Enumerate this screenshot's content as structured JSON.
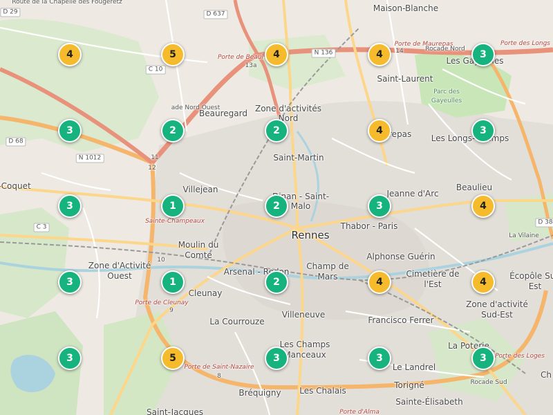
{
  "colors": {
    "green": "#16b37f",
    "amber": "#f6bb2c",
    "water": "#aad3df",
    "park": "#c8e6b8",
    "road": "#f5b56b"
  },
  "markers": [
    {
      "count": "4",
      "status": "amber"
    },
    {
      "count": "5",
      "status": "amber"
    },
    {
      "count": "4",
      "status": "amber"
    },
    {
      "count": "4",
      "status": "amber"
    },
    {
      "count": "3",
      "status": "green"
    },
    {
      "count": "3",
      "status": "green"
    },
    {
      "count": "2",
      "status": "green"
    },
    {
      "count": "2",
      "status": "green"
    },
    {
      "count": "4",
      "status": "amber"
    },
    {
      "count": "3",
      "status": "green"
    },
    {
      "count": "3",
      "status": "green"
    },
    {
      "count": "1",
      "status": "green"
    },
    {
      "count": "2",
      "status": "green"
    },
    {
      "count": "3",
      "status": "green"
    },
    {
      "count": "4",
      "status": "amber"
    },
    {
      "count": "3",
      "status": "green"
    },
    {
      "count": "1",
      "status": "green"
    },
    {
      "count": "2",
      "status": "green"
    },
    {
      "count": "4",
      "status": "amber"
    },
    {
      "count": "4",
      "status": "amber"
    },
    {
      "count": "3",
      "status": "green"
    },
    {
      "count": "5",
      "status": "amber"
    },
    {
      "count": "3",
      "status": "green"
    },
    {
      "count": "3",
      "status": "green"
    },
    {
      "count": "3",
      "status": "green"
    }
  ],
  "labels": {
    "rennes": "Rennes",
    "maison_blanche": "Maison-Blanche",
    "saint_laurent": "Saint-Laurent",
    "beauregard": "Beauregard",
    "zone_nord_1": "Zone d'activités",
    "zone_nord_2": "Nord",
    "saint_martin": "Saint-Martin",
    "villejean": "Villejean",
    "dinan_1": "Dinan - Saint-",
    "dinan_2": "Malo",
    "thabor": "Thabor - Paris",
    "jeanne": "Jeanne d'Arc",
    "beaulieu": "Beaulieu",
    "les_gayeulles": "Les Gayeulles",
    "les_longs_champs": "Les Longs-Champs",
    "maurepas": "Maurepas",
    "moulin_1": "Moulin du",
    "moulin_2": "Comte",
    "zone_ouest_1": "Zone d'Activité",
    "zone_ouest_2": "Ouest",
    "arsenal": "Arsenal - Redon",
    "champ_1": "Champ de",
    "champ_2": "Mars",
    "alphonse": "Alphonse Guérin",
    "cimetiere_1": "Cimetière de",
    "cimetiere_2": "l'Est",
    "ecopole_1": "Écopôle Sud",
    "ecopole_2": "Est",
    "zone_se_1": "Zone d'activité",
    "zone_se_2": "Sud-Est",
    "cleunay": "Cleunay",
    "la_courrouze": "La Courrouze",
    "villeneuve": "Villeneuve",
    "francisco": "Francisco Ferrer",
    "champs_manceaux_1": "Les Champs",
    "champs_manceaux_2": "Manceaux",
    "le_landrel": "Le Landrel",
    "torigne": "Torigné",
    "sainte_elisabeth": "Sainte-Élisabeth",
    "la_poterie": "La Poterie",
    "les_chalais": "Les Chalais",
    "brequigny": "Bréquigny",
    "saint_jacques": "Saint-Jacques",
    "coquet": "-Coquet",
    "ch": "Ch"
  },
  "roads": {
    "d29": "D 29",
    "d637": "D 637",
    "n136": "N 136",
    "c10": "C 10",
    "d68": "D 68",
    "n1012": "N 1012",
    "c3": "C 3",
    "d38": "D 38"
  },
  "small_labels": {
    "route_chapelle": "Route de la Chapelle des Fougeretz",
    "porte_beaulieu": "Porte de Beaul",
    "porte_maurepas": "Porte de Maurepas",
    "rocade_nord": "Rocade Nord",
    "porte_longs": "Porte des Longs",
    "rue_nord_ouest": "ade Nord Ouest",
    "porte_cleunay": "Porte de Cleunay",
    "porte_saint_nazaire": "Porte de Saint-Nazaire",
    "porte_loges": "Porte des Loges",
    "porte_alma": "Porte d'Alma",
    "rocade_sud": "Rocade Sud",
    "la_vilaine": "La Vilaine",
    "parc_gayeulles_1": "Parc des",
    "parc_gayeulles_2": "Gayeulles",
    "champeaux": "Sainte-Champeaux",
    "exit_13a": "13a",
    "exit_14": "14",
    "exit_11": "11",
    "exit_12": "12",
    "exit_10": "10",
    "exit_9": "9",
    "exit_8": "8"
  }
}
